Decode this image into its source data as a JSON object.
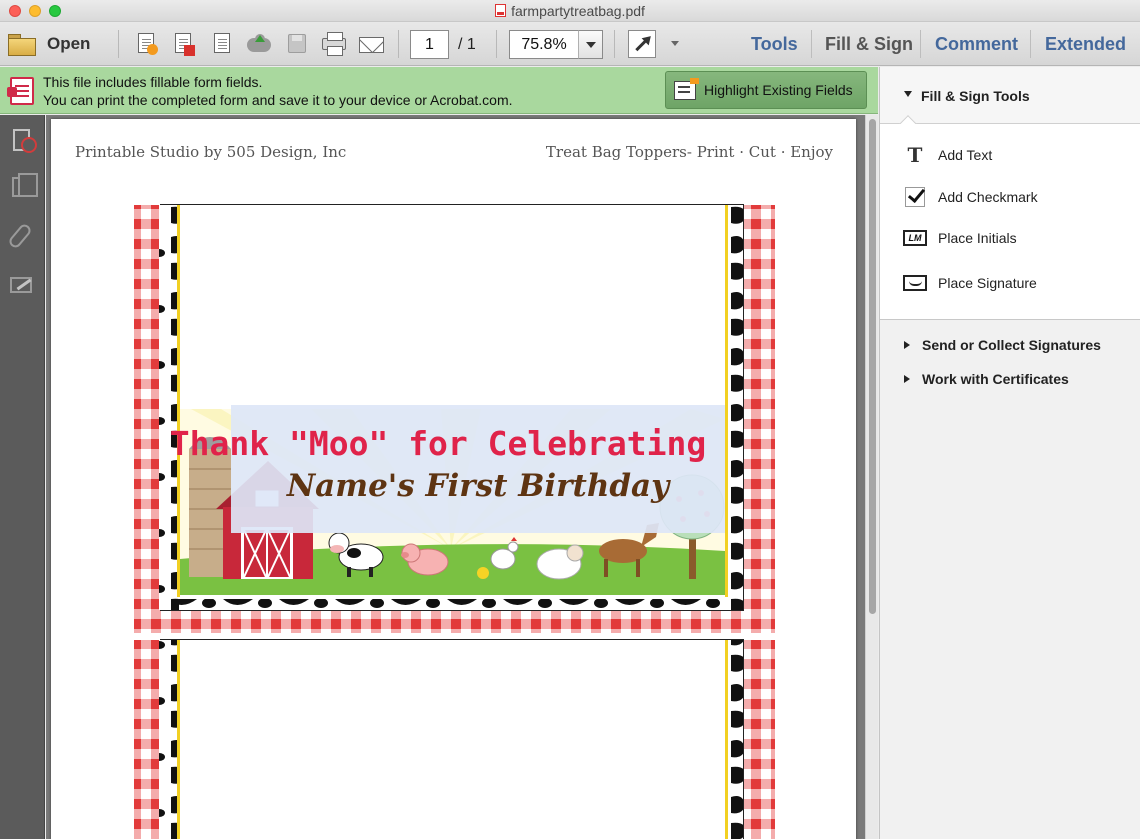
{
  "window": {
    "title": "farmpartytreatbag.pdf"
  },
  "toolbar": {
    "open_label": "Open",
    "page_current": "1",
    "page_total": "/ 1",
    "zoom": "75.8%",
    "tabs": [
      "Tools",
      "Fill & Sign",
      "Comment",
      "Extended"
    ],
    "active_tab": "Fill & Sign"
  },
  "notice": {
    "line1": "This file includes fillable form fields.",
    "line2": "You can print the completed form and save it to your device or Acrobat.com.",
    "button": "Highlight Existing Fields"
  },
  "document": {
    "header_left": "Printable Studio by 505 Design, Inc",
    "header_right": "Treat Bag Toppers- Print · Cut · Enjoy",
    "banner_line1": "Thank \"Moo\" for Celebrating",
    "banner_line2": "Name's First Birthday"
  },
  "panel": {
    "section_title": "Fill & Sign Tools",
    "tools": [
      "Add Text",
      "Add Checkmark",
      "Place Initials",
      "Place Signature"
    ],
    "collapsed_sections": [
      "Send or Collect Signatures",
      "Work with Certificates"
    ]
  },
  "colors": {
    "gingham_red": "#e23b3b",
    "banner_bg": "#dde6f7",
    "banner_title": "#e0234a",
    "banner_name": "#5e3412",
    "accent_blue": "#44689c",
    "notice_green": "#a9d89e"
  }
}
